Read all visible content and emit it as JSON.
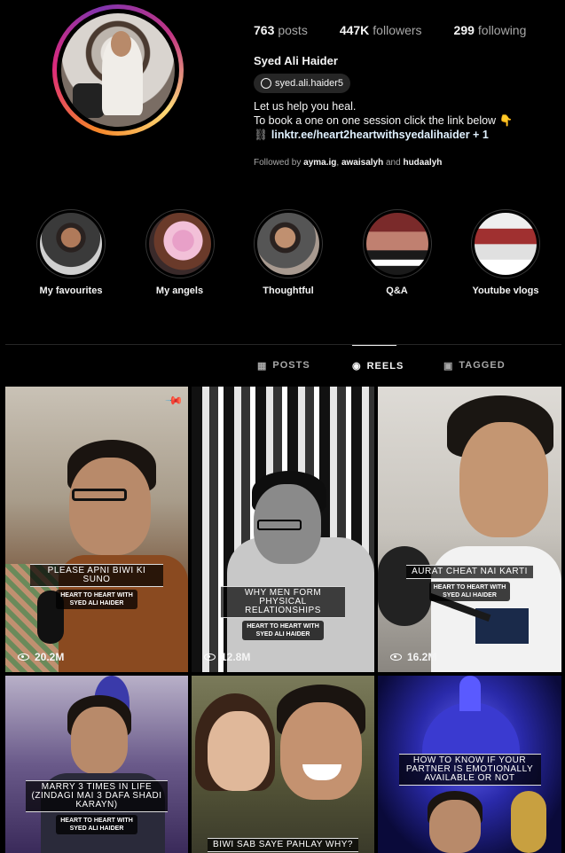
{
  "profile": {
    "stats": {
      "posts_count": "763",
      "posts_label": "posts",
      "followers_count": "447K",
      "followers_label": "followers",
      "following_count": "299",
      "following_label": "following"
    },
    "name": "Syed Ali Haider",
    "threads_handle": "syed.ali.haider5",
    "bio_line1": "Let us help you heal.",
    "bio_line2": "To book a one on one session click the link below 👇",
    "link": "linktr.ee/heart2heartwithsyedalihaider + 1",
    "followed_prefix": "Followed by",
    "followed_user1": "ayma.ig",
    "followed_user2": "awaisalyh",
    "followed_and": "and",
    "followed_user3": "hudaalyh"
  },
  "highlights": [
    {
      "label": "My favourites"
    },
    {
      "label": "My angels"
    },
    {
      "label": "Thoughtful"
    },
    {
      "label": "Q&A"
    },
    {
      "label": "Youtube vlogs"
    }
  ],
  "tabs": {
    "posts": "POSTS",
    "reels": "REELS",
    "tagged": "TAGGED",
    "active": "REELS"
  },
  "reels": [
    {
      "title": "PLEASE APNI BIWI KI SUNO",
      "subtitle_line1": "HEART TO HEART WITH",
      "subtitle_line2": "SYED ALI HAIDER",
      "views": "20.2M",
      "pinned": true
    },
    {
      "title": "WHY MEN FORM PHYSICAL RELATIONSHIPS",
      "subtitle_line1": "HEART TO HEART WITH",
      "subtitle_line2": "SYED ALI HAIDER",
      "views": "12.8M"
    },
    {
      "title": "AURAT CHEAT NAI KARTI",
      "subtitle_line1": "HEART TO HEART WITH",
      "subtitle_line2": "SYED ALI HAIDER",
      "views": "16.2M"
    },
    {
      "title": "MARRY 3 TIMES IN LIFE (ZINDAGI MAI 3 DAFA SHADI KARAYN)",
      "subtitle_line1": "HEART TO HEART WITH",
      "subtitle_line2": "SYED ALI HAIDER"
    },
    {
      "title": "BIWI SAB SAYE PAHLAY WHY?"
    },
    {
      "title": "HOW TO KNOW IF YOUR PARTNER IS EMOTIONALLY AVAILABLE OR NOT"
    }
  ]
}
